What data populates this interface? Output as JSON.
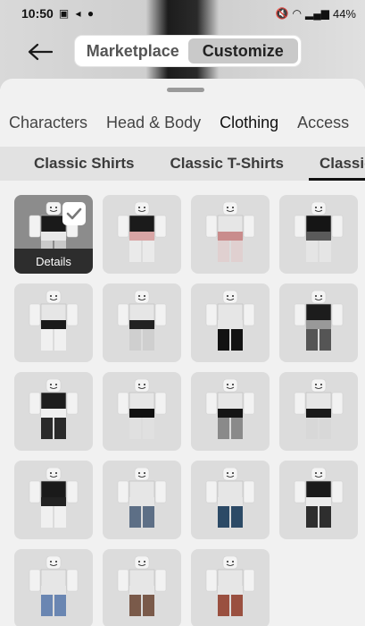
{
  "status_bar": {
    "time": "10:50",
    "battery": "44%"
  },
  "header": {
    "back_icon": "arrow-left-icon",
    "mode_toggle": {
      "options": [
        "Marketplace",
        "Customize"
      ],
      "selected": "Customize"
    }
  },
  "category_tabs": {
    "items": [
      "Characters",
      "Head & Body",
      "Clothing",
      "Access"
    ],
    "selected": "Clothing"
  },
  "sub_tabs": {
    "items": [
      "Classic Shirts",
      "Classic T-Shirts",
      "Classic"
    ],
    "selected": "Classic"
  },
  "items_grid": {
    "details_label": "Details",
    "items": [
      {
        "selected": true,
        "colors": [
          "#1a1a1a",
          "#e8e8e8",
          "#c9c9c9"
        ]
      },
      {
        "selected": false,
        "colors": [
          "#1b1b1b",
          "#d8a5a5",
          "#eaeaea"
        ]
      },
      {
        "selected": false,
        "colors": [
          "#e6e6e6",
          "#c98c8c",
          "#e0d0d0"
        ]
      },
      {
        "selected": false,
        "colors": [
          "#151515",
          "#5a5a5a",
          "#e5e5e5"
        ]
      },
      {
        "selected": false,
        "colors": [
          "#e6e6e6",
          "#1a1a1a",
          "#f0f0f0"
        ]
      },
      {
        "selected": false,
        "colors": [
          "#e6e6e6",
          "#222222",
          "#cfcfcf"
        ]
      },
      {
        "selected": false,
        "colors": [
          "#e6e6e6",
          "#e6e6e6",
          "#121212"
        ]
      },
      {
        "selected": false,
        "colors": [
          "#1c1c1c",
          "#999999",
          "#555555"
        ]
      },
      {
        "selected": false,
        "colors": [
          "#1d1d1d",
          "#f0f0f0",
          "#2a2a2a"
        ]
      },
      {
        "selected": false,
        "colors": [
          "#e6e6e6",
          "#111111",
          "#e0e0e0"
        ]
      },
      {
        "selected": false,
        "colors": [
          "#e6e6e6",
          "#151515",
          "#8a8a8a"
        ]
      },
      {
        "selected": false,
        "colors": [
          "#e6e6e6",
          "#1a1a1a",
          "#d8d8d8"
        ]
      },
      {
        "selected": false,
        "colors": [
          "#1a1a1a",
          "#222222",
          "#f0f0f0"
        ]
      },
      {
        "selected": false,
        "colors": [
          "#e6e6e6",
          "#e6e6e6",
          "#5d6f86"
        ]
      },
      {
        "selected": false,
        "colors": [
          "#e6e6e6",
          "#e6e6e6",
          "#2c4a66"
        ]
      },
      {
        "selected": false,
        "colors": [
          "#1a1a1a",
          "#ececec",
          "#2e2e2e"
        ]
      },
      {
        "selected": false,
        "colors": [
          "#e6e6e6",
          "#e6e6e6",
          "#6a86b2"
        ]
      },
      {
        "selected": false,
        "colors": [
          "#e6e6e6",
          "#e6e6e6",
          "#7a5a4a"
        ]
      },
      {
        "selected": false,
        "colors": [
          "#e6e6e6",
          "#e6e6e6",
          "#9a5040"
        ]
      }
    ]
  },
  "colors": {
    "sheet_background": "#f1f1f1",
    "selected_tile": "#8c8c8c",
    "tile": "#dcdcdc",
    "toggle_active": "#c9c9c9"
  }
}
